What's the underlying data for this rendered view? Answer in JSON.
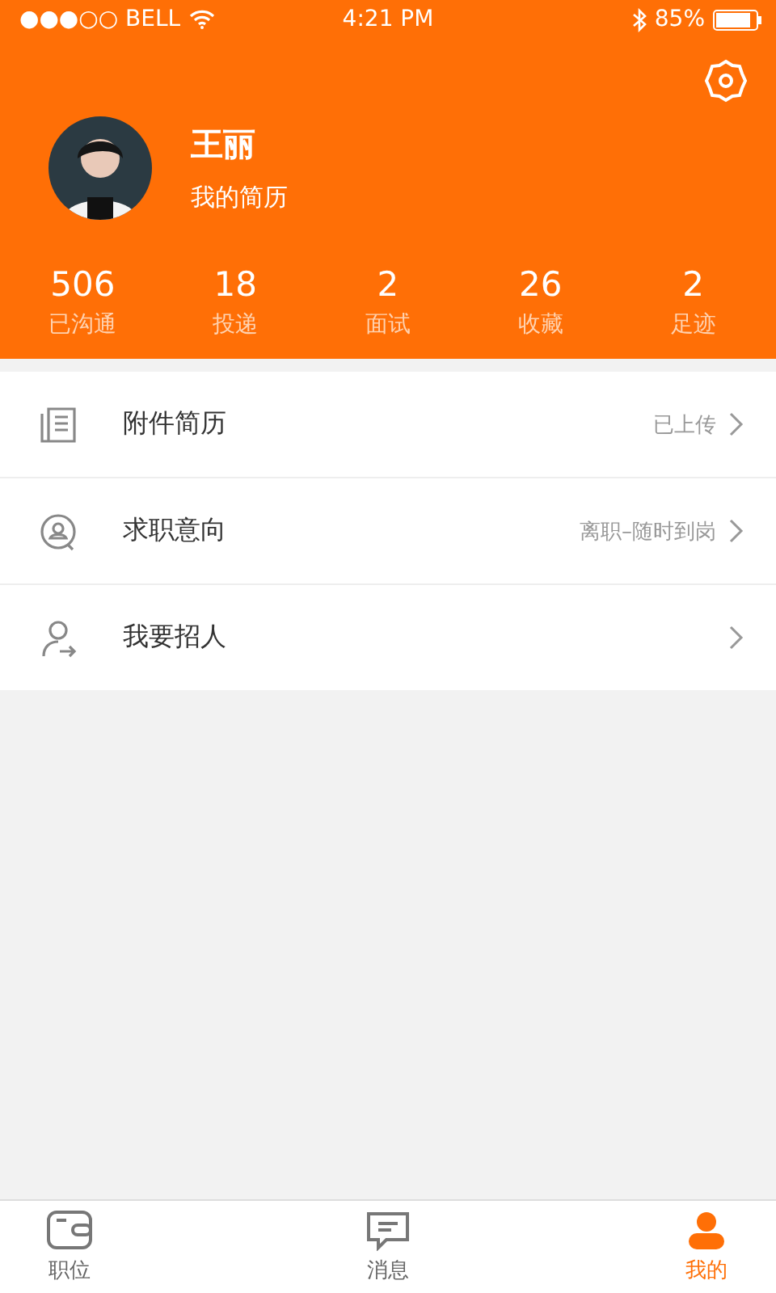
{
  "status_bar": {
    "carrier": "●●●○○ BELL",
    "time": "4:21 PM",
    "battery": "85%"
  },
  "profile": {
    "name": "王丽",
    "subtitle": "我的简历"
  },
  "stats": [
    {
      "value": "506",
      "label": "已沟通"
    },
    {
      "value": "18",
      "label": "投递"
    },
    {
      "value": "2",
      "label": "面试"
    },
    {
      "value": "26",
      "label": "收藏"
    },
    {
      "value": "2",
      "label": "足迹"
    }
  ],
  "menu": [
    {
      "kind": "resume",
      "label": "附件简历",
      "detail": "已上传"
    },
    {
      "kind": "intent",
      "label": "求职意向",
      "detail": "离职–随时到岗"
    },
    {
      "kind": "recruit",
      "label": "我要招人"
    }
  ],
  "tabs": [
    {
      "kind": "jobs",
      "label": "职位",
      "selected": false
    },
    {
      "kind": "messages",
      "label": "消息",
      "selected": false
    },
    {
      "kind": "me",
      "label": "我的",
      "selected": true
    }
  ]
}
